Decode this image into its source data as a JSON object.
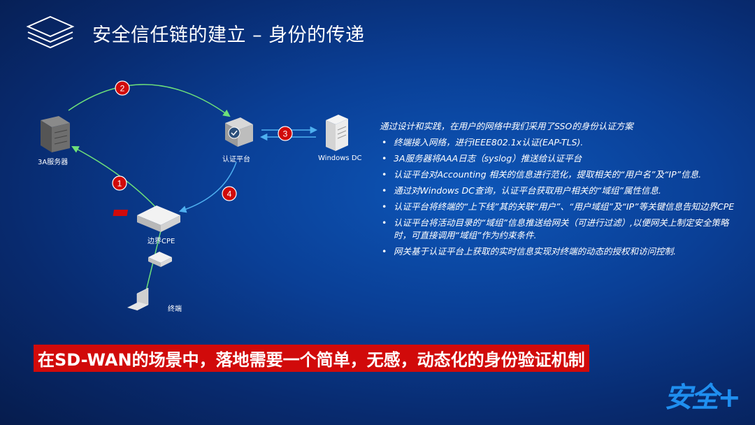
{
  "header": {
    "title": "安全信任链的建立 – 身份的传递"
  },
  "diagram": {
    "nodes": {
      "aaa_server": "3A服务器",
      "auth_platform": "认证平台",
      "windows_dc": "Windows DC",
      "edge_cpe": "边界CPE",
      "terminal": "终端"
    },
    "steps": [
      "1",
      "2",
      "3",
      "4"
    ]
  },
  "content": {
    "intro": "通过设计和实践，在用户的网络中我们采用了SSO的身份认证方案",
    "bullets": [
      "终端接入网络，进行IEEE802.1x认证(EAP-TLS).",
      "3A服务器将AAA日志（syslog）推送给认证平台",
      "认证平台对Accounting 相关的信息进行范化，提取相关的“用户名”及“IP”信息.",
      "通过对Windows DC查询，认证平台获取用户相关的“域组”属性信息.",
      "认证平台将终端的“上下线”其的关联“用户”、“用户域组”及“IP”等关键信息告知边界CPE",
      "认证平台将活动目录的“域组”信息推送给网关（可进行过滤）,以便网关上制定安全策略时，可直接调用“域组”作为约束条件.",
      "网关基于认证平台上获取的实时信息实现对终端的动态的授权和访问控制."
    ]
  },
  "slogan": "在SD-WAN的场景中，落地需要一个简单，无感，动态化的身份验证机制",
  "brand": "安全+",
  "colors": {
    "accent_red": "#d10a0a",
    "arrow_green": "#6ee07a",
    "arrow_blue": "#4fb0f0",
    "brand_blue": "#1f8ff0"
  }
}
